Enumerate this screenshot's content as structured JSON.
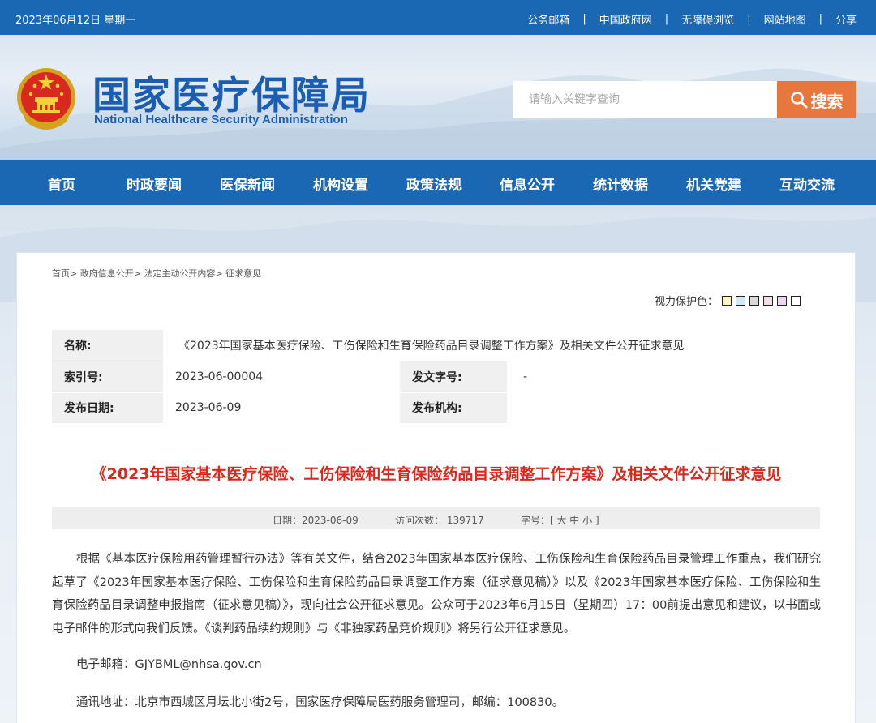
{
  "topbar": {
    "date": "2023年06月12日 星期一",
    "links": [
      "公务邮箱",
      "中国政府网",
      "无障碍浏览",
      "网站地图",
      "分享"
    ],
    "separator": "|"
  },
  "header": {
    "title_cn": "国家医疗保障局",
    "title_en": "National Healthcare Security Administration",
    "search": {
      "placeholder": "请输入关键字查询",
      "button_label": "搜索"
    }
  },
  "nav": {
    "items": [
      "首页",
      "时政要闻",
      "医保新闻",
      "机构设置",
      "政策法规",
      "信息公开",
      "统计数据",
      "机关党建",
      "互动交流"
    ]
  },
  "breadcrumb": {
    "items": [
      "首页",
      "政府信息公开",
      "法定主动公开内容",
      "征求意见"
    ],
    "separator": ">"
  },
  "eye_protection": {
    "label": "视力保护色：",
    "colors": [
      "#fbf4c6",
      "#cfe9f6",
      "#d9d9d9",
      "#f0dde6",
      "#ead7f3",
      "#ffffff"
    ]
  },
  "meta": {
    "name_label": "名称:",
    "name_value": "《2023年国家基本医疗保险、工伤保险和生育保险药品目录调整工作方案》及相关文件公开征求意见",
    "index_label": "索引号:",
    "index_value": "2023-06-00004",
    "docno_label": "发文字号:",
    "docno_value": "-",
    "date_label": "发布日期:",
    "date_value": "2023-06-09",
    "org_label": "发布机构:",
    "org_value": ""
  },
  "article": {
    "title": "《2023年国家基本医疗保险、工伤保险和生育保险药品目录调整工作方案》及相关文件公开征求意见",
    "info": {
      "date": "日期：2023-06-09",
      "visits": "访问次数： 139717",
      "fontsize": "字号：[ 大 中 小 ]"
    },
    "body": "根据《基本医疗保险用药管理暂行办法》等有关文件，结合2023年国家基本医疗保险、工伤保险和生育保险药品目录管理工作重点，我们研究起草了《2023年国家基本医疗保险、工伤保险和生育保险药品目录调整工作方案（征求意见稿）》以及《2023年国家基本医疗保险、工伤保险和生育保险药品目录调整申报指南（征求意见稿）》，现向社会公开征求意见。公众可于2023年6月15日（星期四）17：00前提出意见和建议，以书面或电子邮件的形式向我们反馈。《谈判药品续约规则》与《非独家药品竞价规则》将另行公开征求意见。",
    "email": "电子邮箱：GJYBML@nhsa.gov.cn",
    "address": "通讯地址：北京市西城区月坛北小街2号，国家医疗保障局医药服务管理司，邮编：100830。"
  }
}
